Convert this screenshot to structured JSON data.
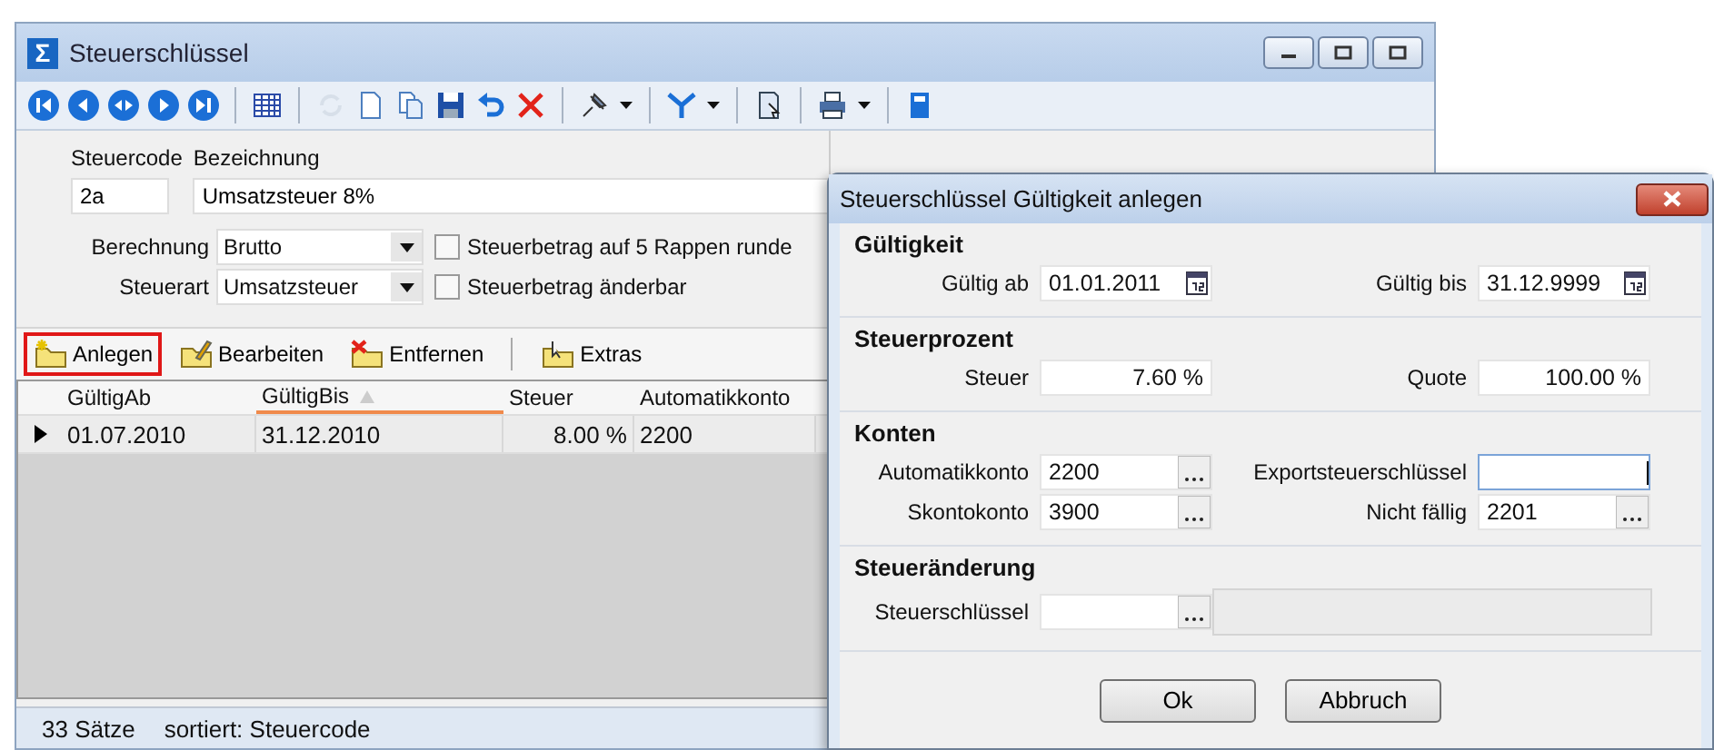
{
  "window": {
    "icon_text": "Σ",
    "title": "Steuerschlüssel"
  },
  "toolbar": [
    {
      "kind": "first",
      "disabled": false
    },
    {
      "kind": "prev",
      "disabled": false
    },
    {
      "kind": "middle",
      "disabled": false
    },
    {
      "kind": "next",
      "disabled": false
    },
    {
      "kind": "last",
      "disabled": false
    },
    {
      "kind": "sep"
    },
    {
      "kind": "grid",
      "disabled": false
    },
    {
      "kind": "sep"
    },
    {
      "kind": "refresh",
      "disabled": true
    },
    {
      "kind": "new",
      "disabled": false
    },
    {
      "kind": "copy",
      "disabled": false
    },
    {
      "kind": "save",
      "disabled": false
    },
    {
      "kind": "undo",
      "disabled": false
    },
    {
      "kind": "delete",
      "disabled": false
    },
    {
      "kind": "sep"
    },
    {
      "kind": "pin",
      "disabled": false
    },
    {
      "kind": "drop",
      "disabled": false
    },
    {
      "kind": "sep"
    },
    {
      "kind": "filter",
      "disabled": false
    },
    {
      "kind": "drop",
      "disabled": false
    },
    {
      "kind": "sep"
    },
    {
      "kind": "doc",
      "disabled": false
    },
    {
      "kind": "sep"
    },
    {
      "kind": "print",
      "disabled": false
    },
    {
      "kind": "drop",
      "disabled": false
    },
    {
      "kind": "sep"
    },
    {
      "kind": "book",
      "disabled": false
    }
  ],
  "form": {
    "steuercode": {
      "label": "Steuercode",
      "value": "2a"
    },
    "bezeichnung": {
      "label": "Bezeichnung",
      "value": "Umsatzsteuer 8%"
    },
    "berechnung": {
      "label": "Berechnung",
      "value": "Brutto"
    },
    "steuerart": {
      "label": "Steuerart",
      "value": "Umsatzsteuer"
    },
    "checkboxes": [
      {
        "label": "Steuerbetrag auf 5 Rappen runde",
        "checked": false
      },
      {
        "label": "Steuerbetrag änderbar",
        "checked": false
      }
    ]
  },
  "actions": [
    {
      "label": "Anlegen",
      "kind": "new",
      "highlighted": true
    },
    {
      "label": "Bearbeiten",
      "kind": "edit",
      "highlighted": false
    },
    {
      "label": "Entfernen",
      "kind": "remove",
      "highlighted": false
    },
    {
      "label": "Extras",
      "kind": "extras",
      "highlighted": false
    }
  ],
  "table": {
    "columns": [
      {
        "label": "GültigAb",
        "sorted": false
      },
      {
        "label": "GültigBis",
        "sorted": true
      },
      {
        "label": "Steuer",
        "sorted": false
      },
      {
        "label": "Automatikkonto",
        "sorted": false
      }
    ],
    "rows": [
      {
        "selected": true,
        "cells": [
          "01.07.2010",
          "31.12.2010",
          "8.00 %",
          "2200"
        ]
      }
    ]
  },
  "status_bar": [
    "33 Sätze",
    "sortiert: Steuercode"
  ],
  "dialog": {
    "title": "Steuerschlüssel Gültigkeit anlegen",
    "sections": [
      {
        "title": "Gültigkeit",
        "rows": [
          [
            {
              "kind": "date",
              "label": "Gültig ab",
              "value": "01.01.2011",
              "focused": false
            },
            {
              "kind": "date",
              "label": "Gültig bis",
              "value": "31.12.9999",
              "focused": false
            }
          ]
        ]
      },
      {
        "title": "Steuerprozent",
        "rows": [
          [
            {
              "kind": "percent",
              "label": "Steuer",
              "value": "7.60 %",
              "focused": false
            },
            {
              "kind": "percent",
              "label": "Quote",
              "value": "100.00 %",
              "focused": false
            }
          ]
        ]
      },
      {
        "title": "Konten",
        "rows": [
          [
            {
              "kind": "lookup",
              "label": "Automatikkonto",
              "value": "2200",
              "focused": false
            },
            {
              "kind": "text",
              "label": "Exportsteuerschlüssel",
              "focused": true
            }
          ],
          [
            {
              "kind": "lookup",
              "label": "Skontokonto",
              "value": "3900",
              "focused": false
            },
            {
              "kind": "lookup",
              "label": "Nicht fällig",
              "value": "2201",
              "focused": false
            }
          ]
        ]
      },
      {
        "title": "Steueränderung",
        "rows": [
          [
            {
              "kind": "lookup_with_description",
              "label": "Steuerschlüssel",
              "focused": false
            }
          ]
        ]
      }
    ],
    "buttons": [
      "Ok",
      "Abbruch"
    ]
  }
}
